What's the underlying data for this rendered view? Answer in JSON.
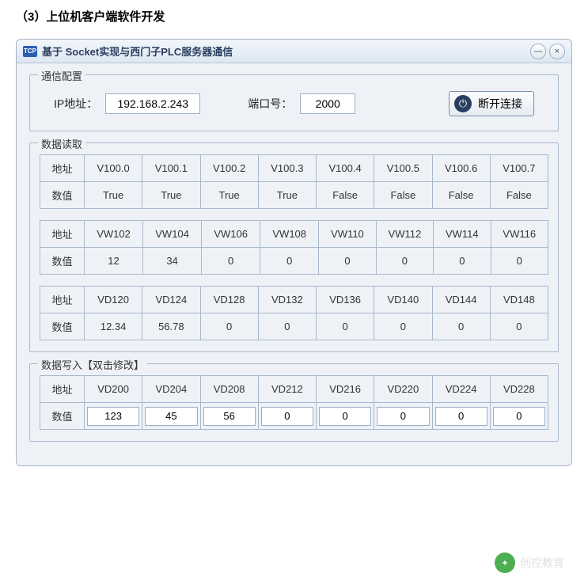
{
  "heading": "（3）上位机客户端软件开发",
  "titlebar": {
    "icon": "TCP",
    "title": "基于 Socket实现与西门子PLC服务器通信"
  },
  "config": {
    "legend": "通信配置",
    "ip_label": "IP地址：",
    "ip_value": "192.168.2.243",
    "port_label": "端口号：",
    "port_value": "2000",
    "disconnect_label": "断开连接"
  },
  "read": {
    "legend": "数据读取",
    "row_addr": "地址",
    "row_val": "数值",
    "t1": {
      "addrs": [
        "V100.0",
        "V100.1",
        "V100.2",
        "V100.3",
        "V100.4",
        "V100.5",
        "V100.6",
        "V100.7"
      ],
      "vals": [
        "True",
        "True",
        "True",
        "True",
        "False",
        "False",
        "False",
        "False"
      ]
    },
    "t2": {
      "addrs": [
        "VW102",
        "VW104",
        "VW106",
        "VW108",
        "VW110",
        "VW112",
        "VW114",
        "VW116"
      ],
      "vals": [
        "12",
        "34",
        "0",
        "0",
        "0",
        "0",
        "0",
        "0"
      ]
    },
    "t3": {
      "addrs": [
        "VD120",
        "VD124",
        "VD128",
        "VD132",
        "VD136",
        "VD140",
        "VD144",
        "VD148"
      ],
      "vals": [
        "12.34",
        "56.78",
        "0",
        "0",
        "0",
        "0",
        "0",
        "0"
      ]
    }
  },
  "write": {
    "legend": "数据写入【双击修改】",
    "row_addr": "地址",
    "row_val": "数值",
    "addrs": [
      "VD200",
      "VD204",
      "VD208",
      "VD212",
      "VD216",
      "VD220",
      "VD224",
      "VD228"
    ],
    "vals": [
      "123",
      "45",
      "56",
      "0",
      "0",
      "0",
      "0",
      "0"
    ]
  },
  "footer": {
    "brand": "创控教育"
  }
}
